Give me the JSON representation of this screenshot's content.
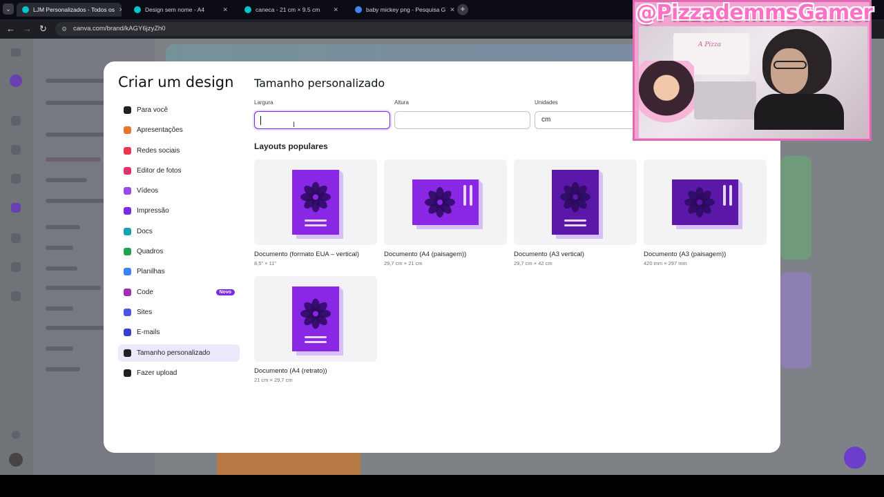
{
  "browser": {
    "tabs": [
      {
        "title": "LJM Personalizados - Todos os",
        "active": true,
        "favicon_color": "#00c4cc"
      },
      {
        "title": "Design sem nome - A4",
        "active": false,
        "favicon_color": "#00c4cc"
      },
      {
        "title": "caneca - 21 cm × 9.5 cm",
        "active": false,
        "favicon_color": "#00c4cc"
      },
      {
        "title": "baby mickey png - Pesquisa G",
        "active": false,
        "favicon_color": "#4285f4"
      }
    ],
    "url": "canva.com/brand/kAGY6jzyZh0"
  },
  "modal": {
    "title": "Criar um design",
    "nav_items": [
      {
        "label": "Para você",
        "icon": "sparkle-icon",
        "color": "#1e2126"
      },
      {
        "label": "Apresentações",
        "icon": "presentation-icon",
        "color": "#e8742d"
      },
      {
        "label": "Redes sociais",
        "icon": "heart-icon",
        "color": "#e8384f"
      },
      {
        "label": "Editor de fotos",
        "icon": "camera-icon",
        "color": "#e1306c"
      },
      {
        "label": "Vídeos",
        "icon": "video-icon",
        "color": "#9b4ae8"
      },
      {
        "label": "Impressão",
        "icon": "printer-icon",
        "color": "#7d2ae8"
      },
      {
        "label": "Docs",
        "icon": "docs-icon",
        "color": "#13a3b5"
      },
      {
        "label": "Quadros",
        "icon": "whiteboard-icon",
        "color": "#20a34e"
      },
      {
        "label": "Planilhas",
        "icon": "sheets-icon",
        "color": "#3b82f6"
      },
      {
        "label": "Code",
        "icon": "code-icon",
        "color": "#9b2fae",
        "badge": "Novo"
      },
      {
        "label": "Sites",
        "icon": "sites-icon",
        "color": "#4b55e0"
      },
      {
        "label": "E-mails",
        "icon": "email-icon",
        "color": "#3b3fd0"
      },
      {
        "label": "Tamanho personalizado",
        "icon": "resize-icon",
        "color": "#1e2126",
        "selected": true
      },
      {
        "label": "Fazer upload",
        "icon": "upload-icon",
        "color": "#1e2126"
      }
    ],
    "custom_size": {
      "title": "Tamanho personalizado",
      "width_label": "Largura",
      "width_value": "",
      "height_label": "Altura",
      "height_value": "",
      "units_label": "Unidades",
      "units_value": "cm"
    },
    "popular": {
      "title": "Layouts populares",
      "layouts": [
        {
          "name": "Documento (formato EUA – vertical)",
          "size": "8,5\" × 11\"",
          "orientation": "portrait",
          "color": "#8a27e4"
        },
        {
          "name": "Documento (A4 (paisagem))",
          "size": "29,7 cm × 21 cm",
          "orientation": "landscape",
          "color": "#8a27e4"
        },
        {
          "name": "Documento (A3 vertical)",
          "size": "29,7 cm × 42 cm",
          "orientation": "portrait",
          "color": "#5b17a8"
        },
        {
          "name": "Documento (A3 (paisagem))",
          "size": "420 mm × 297 mm",
          "orientation": "landscape",
          "color": "#5b17a8"
        },
        {
          "name": "Documento (A4 (retrato))",
          "size": "21 cm × 29,7 cm",
          "orientation": "portrait",
          "color": "#8a27e4"
        }
      ]
    }
  },
  "webcam": {
    "handle": "@PizzademmsGamer",
    "sign": "A Pizza"
  }
}
